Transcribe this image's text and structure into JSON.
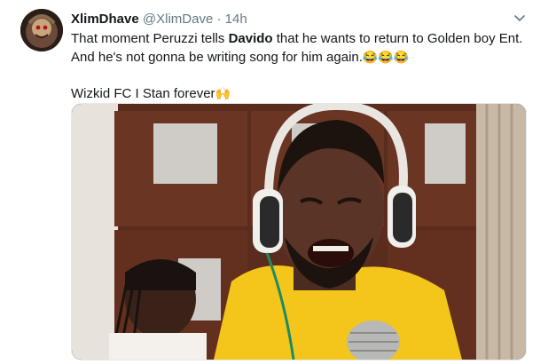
{
  "tweet": {
    "display_name": "XlimDhave",
    "handle": "@XlimDave",
    "separator": "·",
    "time": "14h",
    "text_part1": "That moment Peruzzi tells ",
    "text_bold": "Davido",
    "text_part2": " that he wants to return to Golden boy Ent. And he's not gonna be writing song for him again.",
    "emojis1": "😂😂😂",
    "text_line2": "Wizkid FC I Stan forever",
    "emoji2": "🙌"
  },
  "icons": {
    "menu": "chevron-down-icon",
    "avatar": "avatar"
  },
  "colors": {
    "secondary_text": "#657786",
    "primary_text": "#14171a",
    "border": "#e1e8ed"
  }
}
